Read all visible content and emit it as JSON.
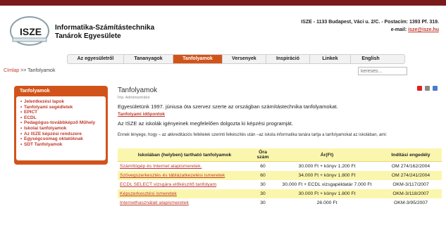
{
  "header": {
    "org_line1": "Informatika-Számítástechnika",
    "org_line2": "Tanárok Egyesülete",
    "contact_line1": "ISZE - 1133 Budapest, Váci u. 2/C. - Postacím: 1393 Pf. 319.",
    "contact_email_label": "e-mail:",
    "contact_email": "isze@isze.hu",
    "logo_text": "ISZE"
  },
  "nav": {
    "items": [
      {
        "label": "Az egyesületről"
      },
      {
        "label": "Tananyagok"
      },
      {
        "label": "Tanfolyamok"
      },
      {
        "label": "Versenyek"
      },
      {
        "label": "Inspiráció"
      },
      {
        "label": "Linkek"
      },
      {
        "label": "English"
      }
    ]
  },
  "breadcrumb": {
    "home": "Címlap",
    "sep": ">>",
    "current": "Tanfolyamok"
  },
  "search": {
    "placeholder": "keresés..."
  },
  "sidebar": {
    "title": "Tanfolyamok",
    "items": [
      {
        "label": "Jelentkezési lapok"
      },
      {
        "label": "Tanfolyami segédletek"
      },
      {
        "label": "EPICT"
      },
      {
        "label": "ECDL"
      },
      {
        "label": "Pedagógus-továbbképző Műhely"
      },
      {
        "label": "Iskolai tanfolyamok"
      },
      {
        "label": "Az ISZE képzési rendszere"
      },
      {
        "label": "Egységcsomag oktatóknak"
      },
      {
        "label": "SDT Tanfolyamok"
      }
    ]
  },
  "content": {
    "title": "Tanfolyamok",
    "author": "Írta: Adminisztrátor",
    "p1": "Egyesületünk 1997. júniusa óta szervez szerte az országban számítástechnika tanfolyamokat.",
    "sub": "Tanfolyami időpontok",
    "p2": "Az ISZE az iskolák igényeinek megfelelően dolgozta ki képzési programját.",
    "p3": "Ennek lényege, hogy – az akkreditációs feltételek szerinti felkészítés után –az iskola informatika tanára tartja a tanfolyamokat az iskolában, ami:"
  },
  "table": {
    "headers": [
      "Iskolában (helyben) tartható tanfolyamok",
      "Óra szám",
      "Ár(Ft)",
      "Indítási engedély"
    ],
    "rows": [
      {
        "name": "Számítógép és Internet alapismeretek.",
        "hours": "60",
        "price": "30.000 Ft + könyv 1.200 Ft",
        "permit": "OM 274/162/2004",
        "hl": false
      },
      {
        "name": "Szövegszerkesztés és táblázatkezelési ismeretek",
        "hours": "60",
        "price": "34.000 Ft + könyv 1.800 Ft",
        "permit": "OM 274/241/2004",
        "hl": true
      },
      {
        "name": "ECDL SELECT vizsgára előkészítő tanfolyam",
        "hours": "30",
        "price": "30.000 Ft + ECDL vizsgapéldatár 7.000 Ft",
        "permit": "OKM-3/117/2007",
        "hl": false
      },
      {
        "name": "Képszerkesztési ismeretek",
        "hours": "30",
        "price": "30.000 Ft + könyv 1.800 Ft",
        "permit": "OKM-3/118/2007",
        "hl": true
      },
      {
        "name": "Internethasználati alapismeretek",
        "hours": "30",
        "price": "26.000 Ft",
        "permit": "OKM-3/95/2007",
        "hl": false
      }
    ]
  }
}
